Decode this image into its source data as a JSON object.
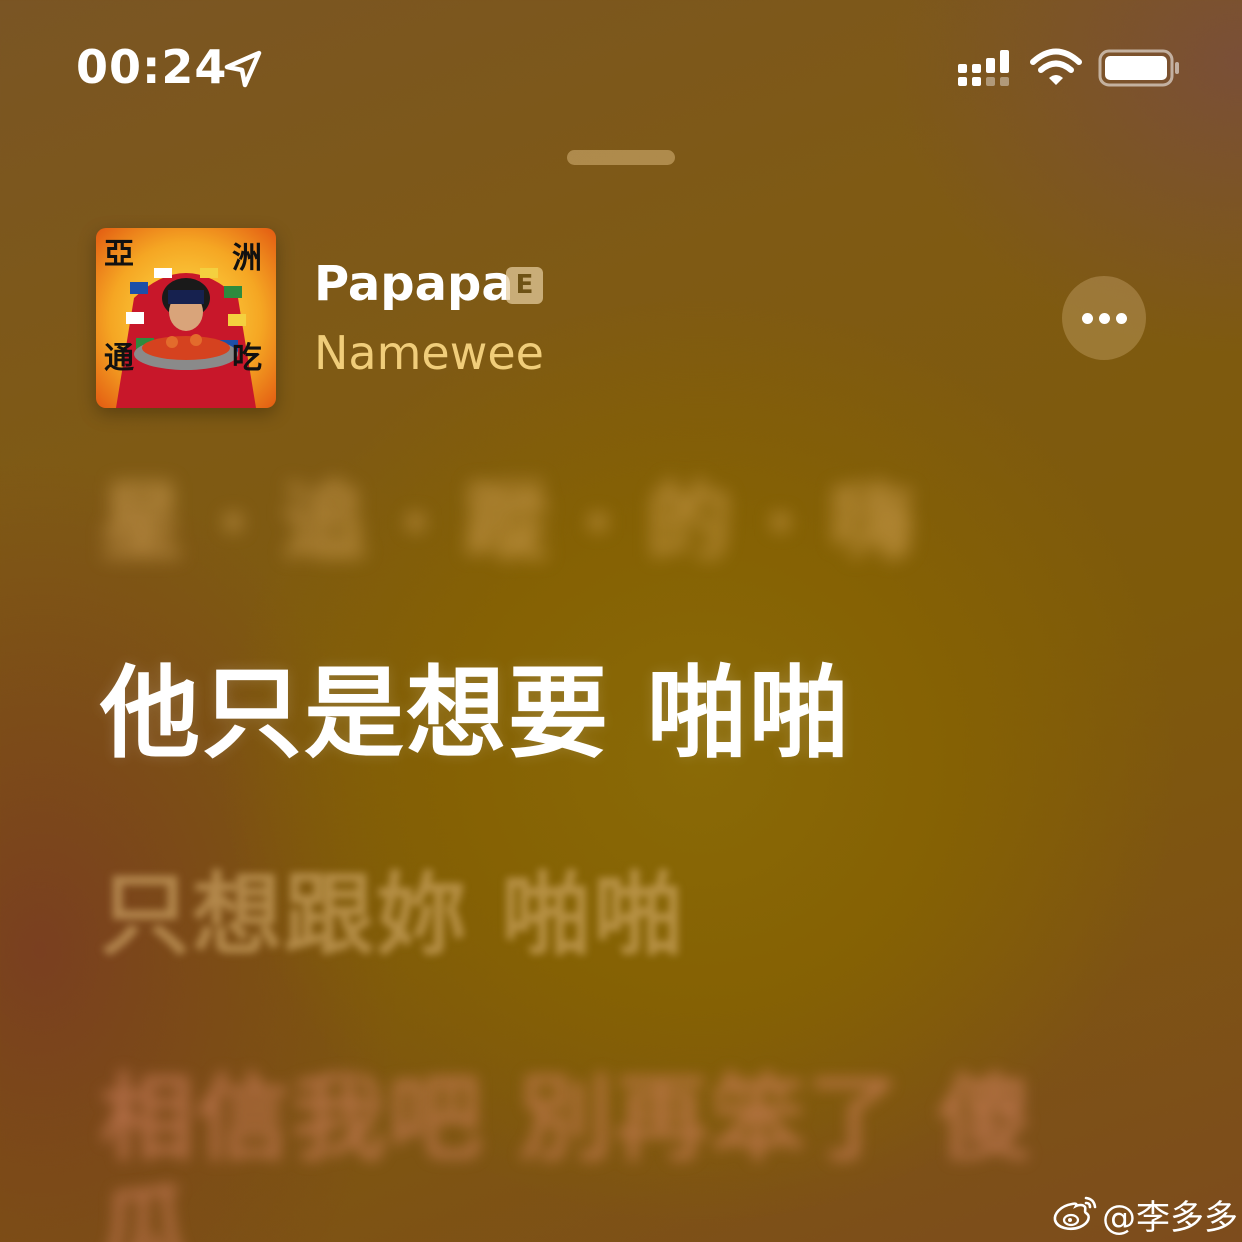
{
  "status_bar": {
    "time": "00:24",
    "location_icon": "location-arrow-icon",
    "signal_icon": "cellular-signal-icon",
    "wifi_icon": "wifi-icon",
    "battery_icon": "battery-icon"
  },
  "now_playing": {
    "title": "Papapa",
    "explicit_badge": "E",
    "artist": "Namewee",
    "album_art": "album-art-image",
    "more_icon": "ellipsis-icon"
  },
  "lyrics": {
    "previous": "星 · 追 · 蹤 · 的 · 嗨",
    "current": "他只是想要 啪啪",
    "next": "只想跟妳 啪啪",
    "upcoming_1": "相信我吧 別再笨了 傻",
    "upcoming_2": "瓜"
  },
  "watermark": {
    "icon": "weibo-icon",
    "text": "@李多多"
  },
  "colors": {
    "background": "#7f5a14",
    "artist": "#f0cd7a",
    "current_lyric": "#ffffff"
  }
}
